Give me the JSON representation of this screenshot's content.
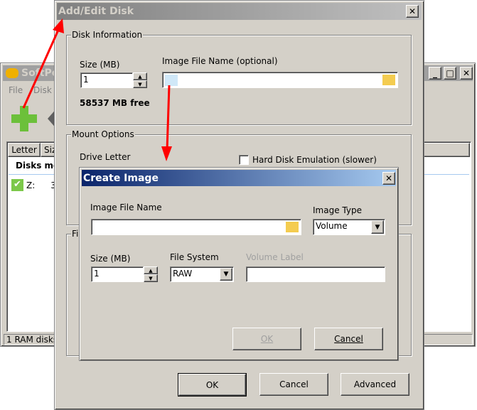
{
  "main_window": {
    "title": "SoftPe",
    "menu": [
      "File",
      "Disk"
    ],
    "columns": [
      "Letter",
      "Siz"
    ],
    "group_row": "Disks mo",
    "disk_row": {
      "letter": "Z:",
      "size": "32"
    },
    "status": "1 RAM disks"
  },
  "add_edit": {
    "title": "Add/Edit Disk",
    "disk_info": {
      "legend": "Disk Information",
      "size_label": "Size (MB)",
      "size_value": "1",
      "image_label": "Image File Name (optional)",
      "image_value": "",
      "free": "58537 MB free"
    },
    "mount": {
      "legend": "Mount Options",
      "drive_letter_label": "Drive Letter",
      "hdd_emulation_label": "Hard Disk Emulation (slower)",
      "hdd_emulation_checked": false
    },
    "fs_legend": "Fi",
    "buttons": {
      "ok": "OK",
      "cancel": "Cancel",
      "advanced": "Advanced"
    }
  },
  "create_image": {
    "title": "Create Image",
    "image_name_label": "Image File Name",
    "image_name_value": "",
    "image_type_label": "Image Type",
    "image_type_value": "Volume",
    "size_label": "Size (MB)",
    "size_value": "1",
    "fs_label": "File System",
    "fs_value": "RAW",
    "volume_label": "Volume Label",
    "volume_value": "",
    "ok": "OK",
    "cancel": "Cancel"
  },
  "colors": {
    "active_title_start": "#0a246a",
    "active_title_end": "#a6caf0",
    "inactive_title": "#808080",
    "arrow": "#ff0000"
  }
}
